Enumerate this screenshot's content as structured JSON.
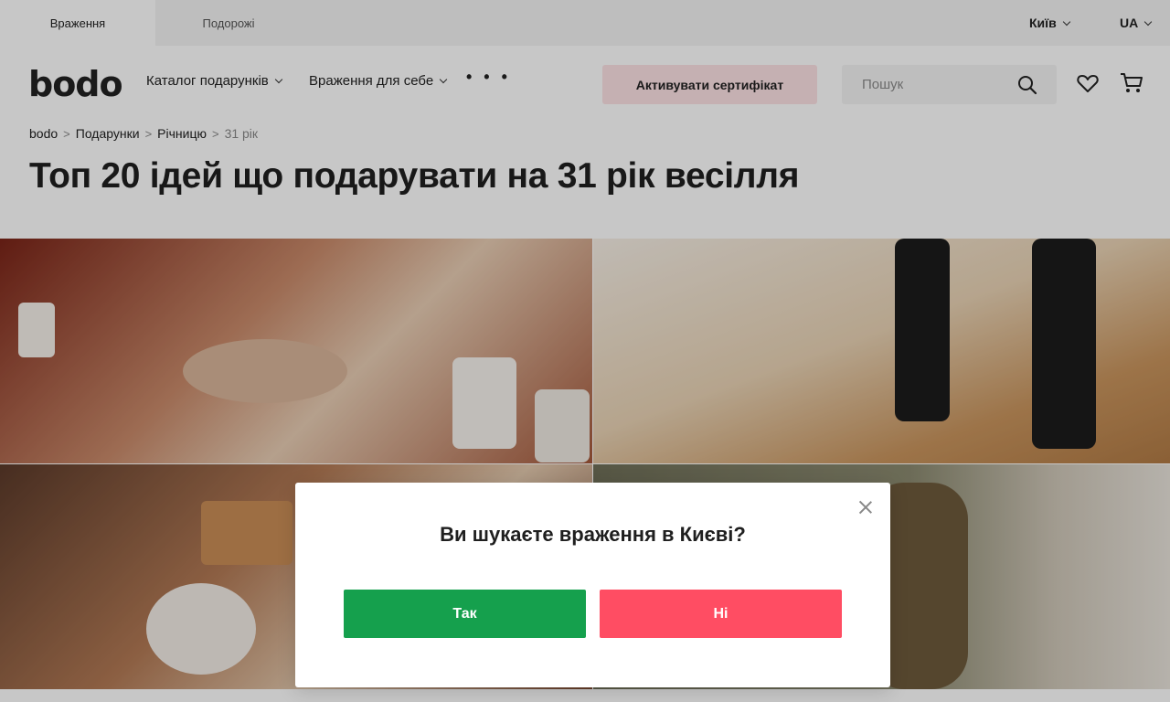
{
  "topbar": {
    "tabs": [
      {
        "label": "Враження"
      },
      {
        "label": "Подорожі"
      }
    ],
    "city": "Київ",
    "language": "UA"
  },
  "header": {
    "logo": "bodo",
    "nav": [
      {
        "label": "Каталог подарунків"
      },
      {
        "label": "Враження для себе"
      }
    ],
    "more": "• • •",
    "activate_label": "Активувати сертифікат",
    "search_placeholder": "Пошук"
  },
  "breadcrumb": [
    "bodo",
    "Подарунки",
    "Річницю",
    "31 рік"
  ],
  "page_title": "Топ 20 ідей що подарувати на 31 рік весілля",
  "modal": {
    "question": "Ви шукаєте враження в Києві?",
    "yes_label": "Так",
    "no_label": "Ні"
  },
  "colors": {
    "accent_pink": "#fde2e5",
    "yes_green": "#15a04d",
    "no_red": "#ff4d63"
  }
}
